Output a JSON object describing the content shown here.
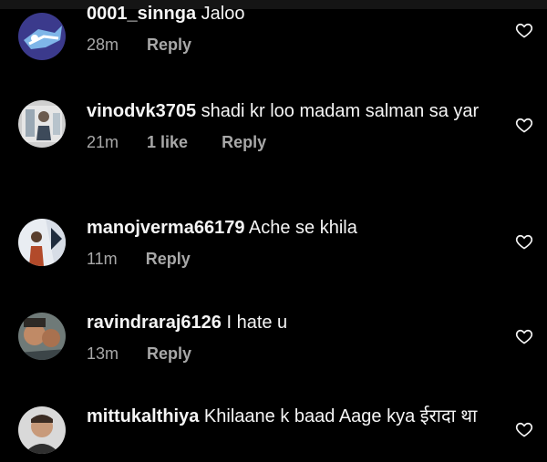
{
  "comments": [
    {
      "username": "0001_sinnga",
      "text": "Jaloo",
      "time": "28m",
      "likes": "",
      "reply_label": "Reply"
    },
    {
      "username": "vinodvk3705",
      "text": "shadi kr loo madam salman sa yar",
      "time": "21m",
      "likes": "1 like",
      "reply_label": "Reply"
    },
    {
      "username": "manojverma66179",
      "text": "Ache se khila",
      "time": "11m",
      "likes": "",
      "reply_label": "Reply"
    },
    {
      "username": "ravindraraj6126",
      "text": "I hate u",
      "time": "13m",
      "likes": "",
      "reply_label": "Reply"
    },
    {
      "username": "mittukalthiya",
      "text": "Khilaane  k baad  Aage  kya ईरादा था",
      "time": "",
      "likes": "",
      "reply_label": ""
    }
  ],
  "icons": {
    "like": "heart-outline-icon",
    "avatar": "profile-photo"
  },
  "colors": {
    "background": "#000000",
    "text": "#f5f5f5",
    "secondary": "#a8a8a8"
  }
}
